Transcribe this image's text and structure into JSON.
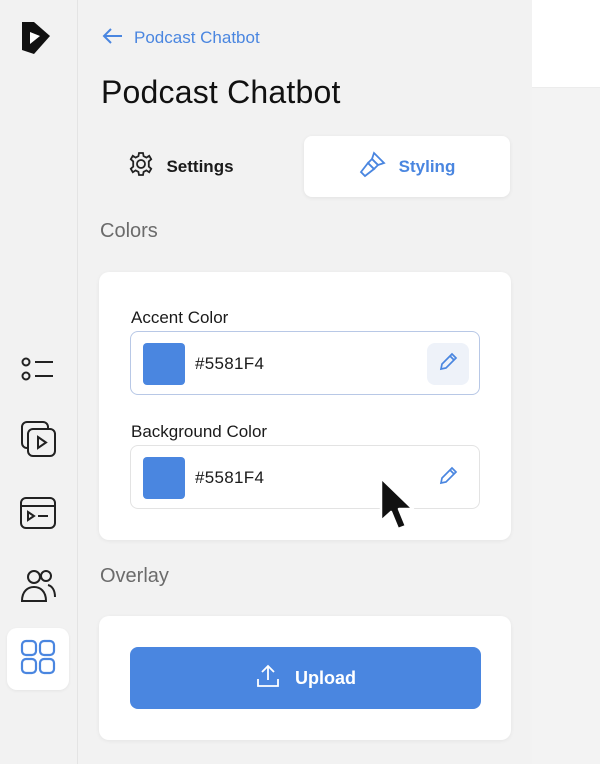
{
  "back_link": {
    "label": "Podcast Chatbot",
    "icon": "arrow-left-icon"
  },
  "page_title": "Podcast Chatbot",
  "tabs": [
    {
      "label": "Settings",
      "icon": "gear-icon",
      "active": false
    },
    {
      "label": "Styling",
      "icon": "paintbrush-icon",
      "active": true
    }
  ],
  "sections": {
    "colors": {
      "title": "Colors",
      "fields": [
        {
          "label": "Accent Color",
          "value": "#5581F4",
          "swatch": "#4a86e0",
          "focused": true
        },
        {
          "label": "Background Color",
          "value": "#5581F4",
          "swatch": "#4a86e0",
          "focused": false
        }
      ]
    },
    "overlay": {
      "title": "Overlay",
      "upload_label": "Upload",
      "upload_icon": "upload-icon"
    }
  },
  "rail": {
    "logo": "app-logo",
    "items": [
      {
        "icon": "list-icon",
        "active": false
      },
      {
        "icon": "video-library-icon",
        "active": false
      },
      {
        "icon": "player-window-icon",
        "active": false
      },
      {
        "icon": "users-icon",
        "active": false
      },
      {
        "icon": "grid-icon",
        "active": true
      }
    ]
  },
  "colors": {
    "accent": "#4a86e0",
    "panel_bg": "#f2f2f2",
    "card_bg": "#ffffff"
  }
}
